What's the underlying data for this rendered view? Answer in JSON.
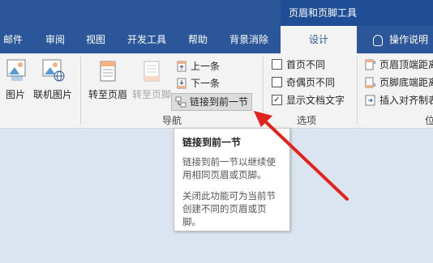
{
  "context_title": "页眉和页脚工具",
  "tabs": [
    "邮件",
    "审阅",
    "视图",
    "开发工具",
    "帮助",
    "背景消除",
    "设计"
  ],
  "tell_me": "操作说明",
  "ribbon": {
    "picture_label": "图片",
    "online_picture_label": "联机图片",
    "goto_header_label": "转至页眉",
    "goto_footer_label": "转至页脚",
    "prev_label": "上一条",
    "next_label": "下一条",
    "link_prev_label": "链接到前一节",
    "nav_group_label": "导航",
    "options": {
      "first_page_diff": "首页不同",
      "odd_even_diff": "奇偶页不同",
      "show_doc_text": "显示文档文字",
      "checked": [
        false,
        false,
        true
      ]
    },
    "options_group_label": "选项",
    "position": {
      "header_top": "页眉顶端距离",
      "footer_bottom": "页脚底端距离",
      "insert_align_tab": "插入对齐制表"
    },
    "position_group_label": "位"
  },
  "tooltip": {
    "title": "链接到前一节",
    "p1": "链接到前一节以继续使用相同页眉或页脚。",
    "p2": "关闭此功能可为当前节创建不同的页眉或页脚。"
  },
  "colors": {
    "accent": "#2b579a",
    "arrow": "#e3231b"
  }
}
